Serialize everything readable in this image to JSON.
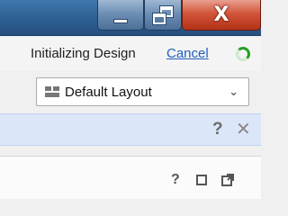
{
  "titlebar": {
    "minimize_icon": "minimize-icon",
    "maximize_icon": "restore-window-icon",
    "close_icon": "close-icon",
    "close_glyph": "X"
  },
  "status": {
    "text": "Initializing Design",
    "cancel_label": "Cancel",
    "spinner_icon": "loading-spinner-icon",
    "spinner_color": "#25a025"
  },
  "layout_select": {
    "icon": "layout-grid-icon",
    "value": "Default Layout",
    "chevron_icon": "chevron-down-icon"
  },
  "info_bar": {
    "background": "#dbe7f9",
    "help_glyph": "?",
    "close_glyph": "✕"
  },
  "panel": {
    "help_glyph": "?",
    "restore_icon": "restore-panel-icon",
    "float_icon": "float-window-icon"
  }
}
